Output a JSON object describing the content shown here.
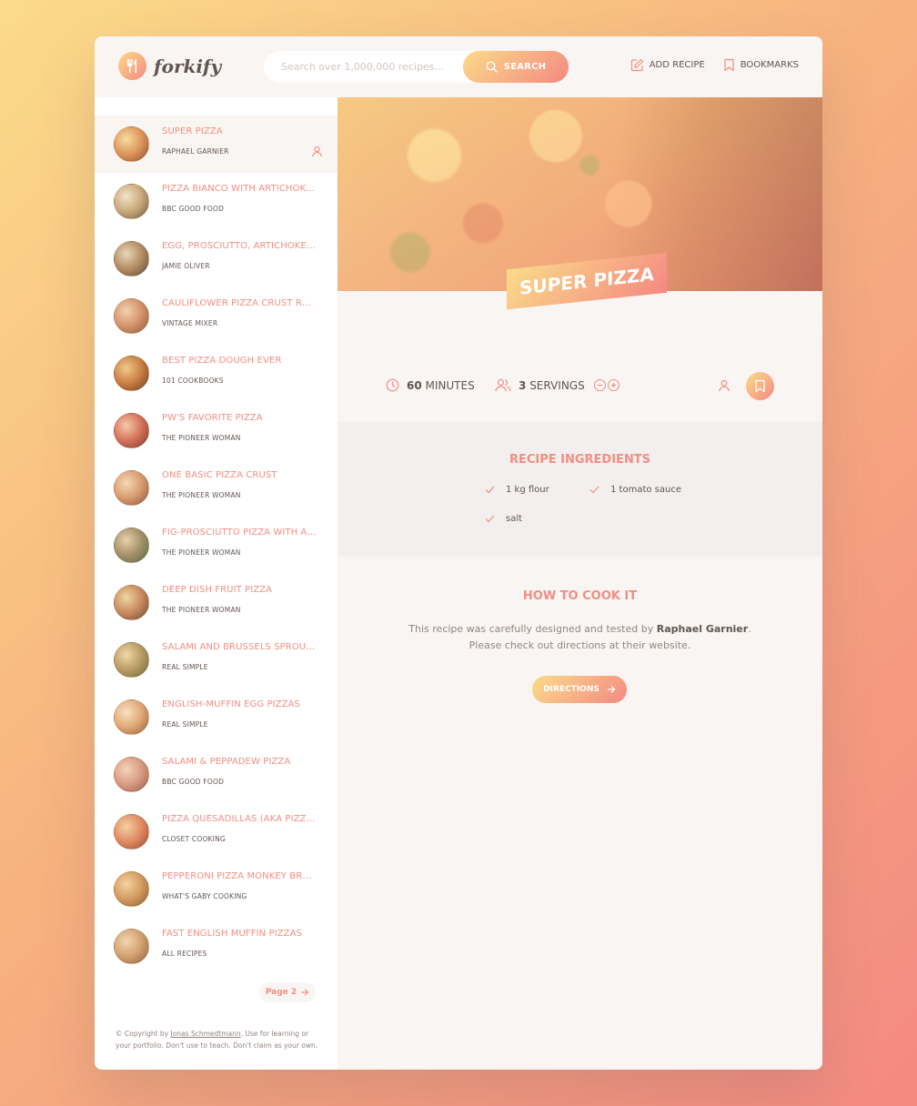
{
  "header": {
    "logo_text": "forkify",
    "search_placeholder": "Search over 1,000,000 recipes...",
    "search_label": "SEARCH",
    "add_recipe_label": "ADD RECIPE",
    "bookmarks_label": "BOOKMARKS"
  },
  "results": [
    {
      "title": "SUPER PIZZA",
      "publisher": "RAPHAEL GARNIER",
      "active": true,
      "user_generated": true
    },
    {
      "title": "PIZZA BIANCO WITH ARTICHOKE ...",
      "publisher": "BBC GOOD FOOD"
    },
    {
      "title": "EGG, PROSCIUTTO, ARTICHOKES, ...",
      "publisher": "JAMIE OLIVER"
    },
    {
      "title": "CAULIFLOWER PIZZA CRUST RECI...",
      "publisher": "VINTAGE MIXER"
    },
    {
      "title": "BEST PIZZA DOUGH EVER",
      "publisher": "101 COOKBOOKS"
    },
    {
      "title": "PW'S FAVORITE PIZZA",
      "publisher": "THE PIONEER WOMAN"
    },
    {
      "title": "ONE BASIC PIZZA CRUST",
      "publisher": "THE PIONEER WOMAN"
    },
    {
      "title": "FIG-PROSCIUTTO PIZZA WITH AR...",
      "publisher": "THE PIONEER WOMAN"
    },
    {
      "title": "DEEP DISH FRUIT PIZZA",
      "publisher": "THE PIONEER WOMAN"
    },
    {
      "title": "SALAMI AND BRUSSELS SPROUTS...",
      "publisher": "REAL SIMPLE"
    },
    {
      "title": "ENGLISH-MUFFIN EGG PIZZAS",
      "publisher": "REAL SIMPLE"
    },
    {
      "title": "SALAMI & PEPPADEW PIZZA",
      "publisher": "BBC GOOD FOOD"
    },
    {
      "title": "PIZZA QUESADILLAS (AKA PIZZAD...",
      "publisher": "CLOSET COOKING"
    },
    {
      "title": "PEPPERONI PIZZA MONKEY BREAD",
      "publisher": "WHAT'S GABY COOKING"
    },
    {
      "title": "FAST ENGLISH MUFFIN PIZZAS",
      "publisher": "ALL RECIPES"
    }
  ],
  "pagination": {
    "next_label": "Page 2"
  },
  "copyright": {
    "prefix": "© Copyright by ",
    "author": "Jonas Schmedtmann",
    "suffix": ". Use for learning or your portfolio. Don't use to teach. Don't claim as your own."
  },
  "recipe": {
    "title": "SUPER PIZZA",
    "minutes": "60",
    "minutes_label": "MINUTES",
    "servings": "3",
    "servings_label": "SERVINGS",
    "ingredients_title": "RECIPE INGREDIENTS",
    "ingredients": [
      "1 kg flour",
      "1 tomato sauce",
      "salt"
    ],
    "cook_title": "HOW TO COOK IT",
    "cook_text_before": "This recipe was carefully designed and tested by ",
    "cook_publisher": "Raphael Garnier",
    "cook_text_after": ". Please check out directions at their website.",
    "directions_label": "DIRECTIONS"
  },
  "colors": {
    "accent": "#f38e82",
    "gradient_start": "#fbdb89",
    "gradient_end": "#f48982",
    "text": "#615551",
    "light_bg": "#f9f5f3"
  }
}
